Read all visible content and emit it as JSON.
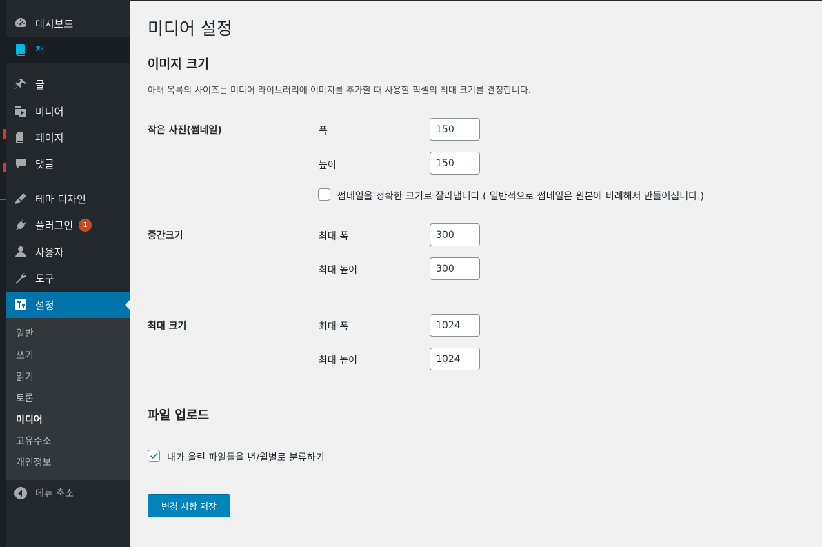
{
  "sidebar": {
    "menu": [
      {
        "id": "dashboard",
        "label": "대시보드",
        "icon": "dashboard-icon"
      },
      {
        "id": "book",
        "label": "책",
        "icon": "book-icon"
      },
      {
        "id": "posts",
        "label": "글",
        "icon": "pin-icon"
      },
      {
        "id": "media",
        "label": "미디어",
        "icon": "media-icon"
      },
      {
        "id": "pages",
        "label": "페이지",
        "icon": "page-icon"
      },
      {
        "id": "comments",
        "label": "댓글",
        "icon": "comment-icon"
      },
      {
        "id": "appearance",
        "label": "테마 디자인",
        "icon": "brush-icon"
      },
      {
        "id": "plugins",
        "label": "플러그인",
        "icon": "plugin-icon",
        "badge": "1"
      },
      {
        "id": "users",
        "label": "사용자",
        "icon": "user-icon"
      },
      {
        "id": "tools",
        "label": "도구",
        "icon": "wrench-icon"
      },
      {
        "id": "settings",
        "label": "설정",
        "icon": "settings-icon"
      }
    ],
    "submenu": [
      "일반",
      "쓰기",
      "읽기",
      "토론",
      "미디어",
      "고유주소",
      "개인정보"
    ],
    "submenu_active": "미디어",
    "collapse_label": "메뉴 축소"
  },
  "page": {
    "title": "미디어 설정",
    "image_sizes_heading": "이미지 크기",
    "image_sizes_desc": "아래 목록의 사이즈는 미디어 라이브러리에 이미지를 추가할 때 사용할 픽셀의 최대 크기를 결정합니다.",
    "thumbnail": {
      "title": "작은 사진(썸네일)",
      "width_label": "폭",
      "width_value": "150",
      "height_label": "높이",
      "height_value": "150",
      "crop_label": "썸네일을 정확한 크기로 잘라냅니다.( 일반적으로 썸네일은 원본에 비례해서 만들어집니다.)",
      "crop_checked": false
    },
    "medium": {
      "title": "중간크기",
      "width_label": "최대 폭",
      "width_value": "300",
      "height_label": "최대 높이",
      "height_value": "300"
    },
    "large": {
      "title": "최대 크기",
      "width_label": "최대 폭",
      "width_value": "1024",
      "height_label": "최대 높이",
      "height_value": "1024"
    },
    "uploads_heading": "파일 업로드",
    "uploads_checkbox_label": "내가 올린 파일들을 년/월별로 분류하기",
    "uploads_checked": true,
    "save_label": "변경 사항 저장"
  },
  "colors": {
    "sidebar_bg": "#23282d",
    "accent": "#0073aa",
    "button": "#0085ba",
    "badge": "#ca4a1f",
    "highlight_text": "#00b9eb"
  }
}
